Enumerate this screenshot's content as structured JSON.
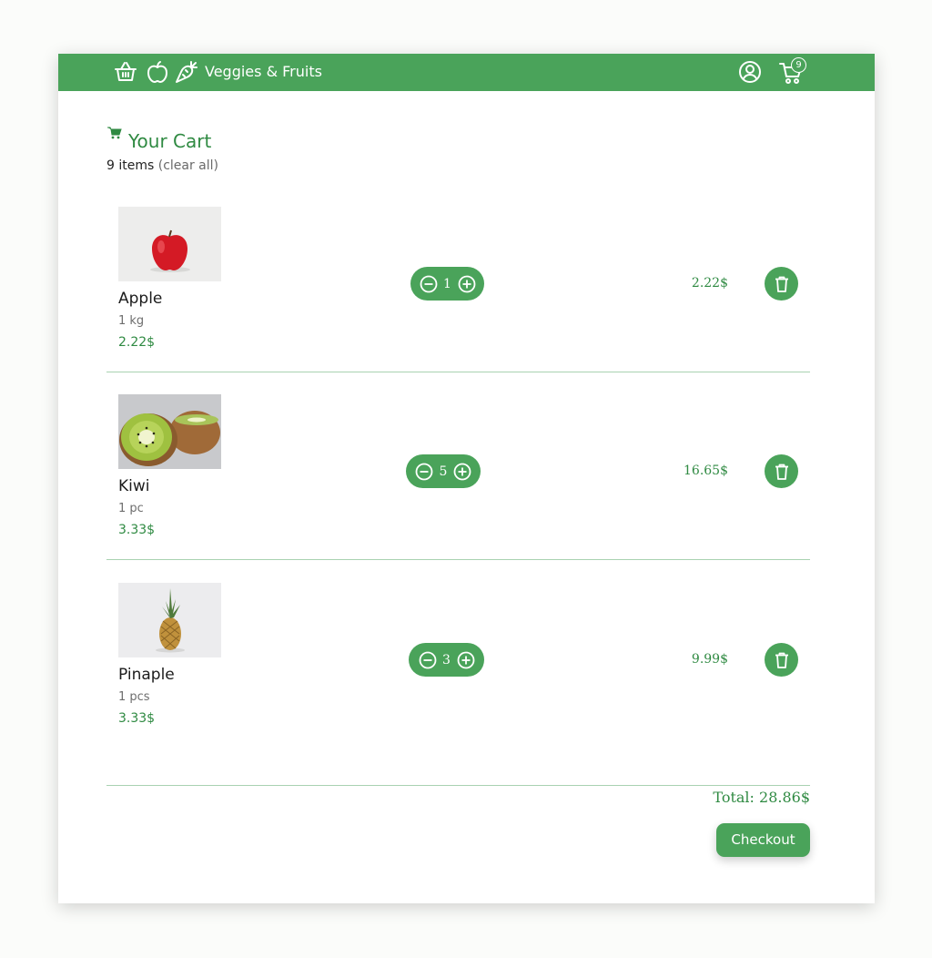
{
  "navbar": {
    "brand": "Veggies & Fruits",
    "icons": [
      "basket-icon",
      "apple-icon",
      "carrot-icon",
      "user-icon",
      "cart-icon"
    ],
    "cart_badge": "9",
    "bg_color": "#4aa35a"
  },
  "cart": {
    "title": "Your Cart",
    "count_label": "9 items",
    "clear_label": "(clear all)",
    "items": [
      {
        "name": "Apple",
        "unit": "1 kg",
        "price": "2.22$",
        "quantity": "1",
        "line_total": "2.22$"
      },
      {
        "name": "Kiwi",
        "unit": "1 pc",
        "price": "3.33$",
        "quantity": "5",
        "line_total": "16.65$"
      },
      {
        "name": "Pinaple",
        "unit": "1 pcs",
        "price": "3.33$",
        "quantity": "3",
        "line_total": "9.99$"
      }
    ],
    "total": "Total: 28.86$",
    "checkout_label": "Checkout"
  },
  "colors": {
    "accent": "#4aa35a",
    "accent_text": "#2f8a42",
    "divider": "#a9d2b1"
  }
}
